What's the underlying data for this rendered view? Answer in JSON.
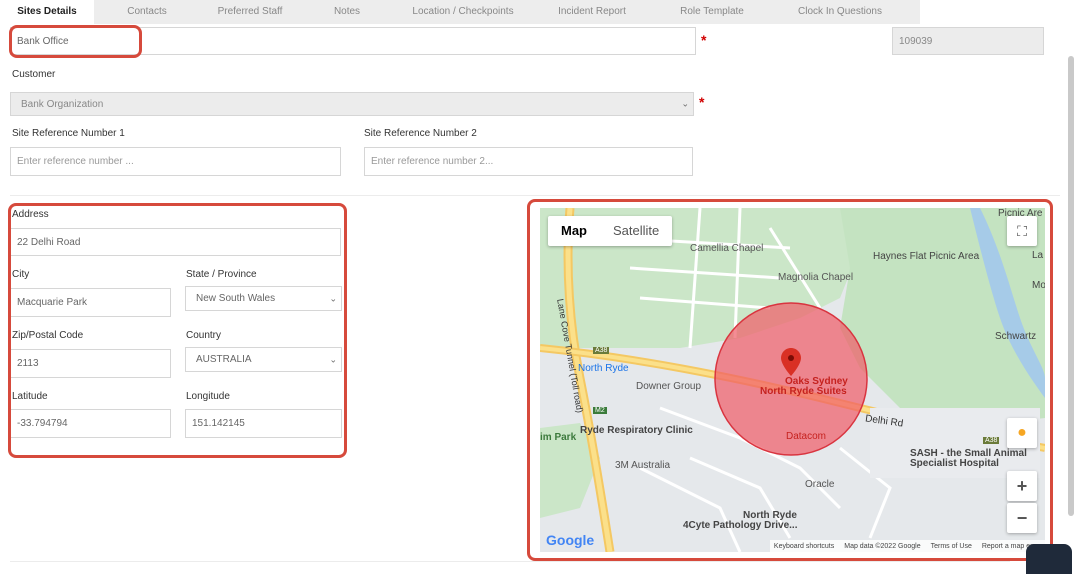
{
  "tabs": [
    {
      "label": "Sites Details"
    },
    {
      "label": "Contacts"
    },
    {
      "label": "Preferred Staff"
    },
    {
      "label": "Notes"
    },
    {
      "label": "Location / Checkpoints"
    },
    {
      "label": "Incident Report"
    },
    {
      "label": "Role Template"
    },
    {
      "label": "Clock In Questions"
    }
  ],
  "site": {
    "name": "Bank Office",
    "id": "109039"
  },
  "customer": {
    "label": "Customer",
    "value": "Bank Organization"
  },
  "ref1": {
    "label": "Site Reference Number 1",
    "placeholder": "Enter reference number ..."
  },
  "ref2": {
    "label": "Site Reference Number 2",
    "placeholder": "Enter reference number 2..."
  },
  "address": {
    "label": "Address",
    "value": "22 Delhi Road",
    "city_label": "City",
    "city": "Macquarie Park",
    "state_label": "State / Province",
    "state": "New South Wales",
    "zip_label": "Zip/Postal Code",
    "zip": "2113",
    "country_label": "Country",
    "country": "AUSTRALIA",
    "lat_label": "Latitude",
    "lat": "-33.794794",
    "lng_label": "Longitude",
    "lng": "151.142145"
  },
  "map": {
    "type_map": "Map",
    "type_satellite": "Satellite",
    "places": {
      "camellia": "Camellia Chapel",
      "magnolia": "Magnolia Chapel",
      "haynes": "Haynes Flat Picnic Area",
      "picnic": "Picnic Are",
      "north_ryde": "North Ryde",
      "downer": "Downer Group",
      "oaks1": "Oaks Sydney",
      "oaks2": "North Ryde Suites",
      "ryde_resp": "Ryde Respiratory Clinic",
      "im_park": "im Park",
      "datacom": "Datacom",
      "three_m": "3M Australia",
      "sash1": "SASH - the Small Animal",
      "sash2": "Specialist Hospital",
      "oracle": "Oracle",
      "nr2": "North Ryde",
      "cyte": "4Cyte Pathology Drive...",
      "schwartz": "Schwartz",
      "delhi": "Delhi Rd",
      "tollroad": "Lane Cove Tunnel (Toll road)",
      "mo": "Mo",
      "la": "La",
      "a38": "A38",
      "a38b": "A38",
      "m2": "M2"
    },
    "footer": {
      "shortcuts": "Keyboard shortcuts",
      "data": "Map data ©2022 Google",
      "terms": "Terms of Use",
      "report": "Report a map error"
    },
    "google": "Google"
  },
  "colors": {
    "accent": "#d64a3c",
    "required": "#d10000",
    "circle": "#f15b67"
  }
}
